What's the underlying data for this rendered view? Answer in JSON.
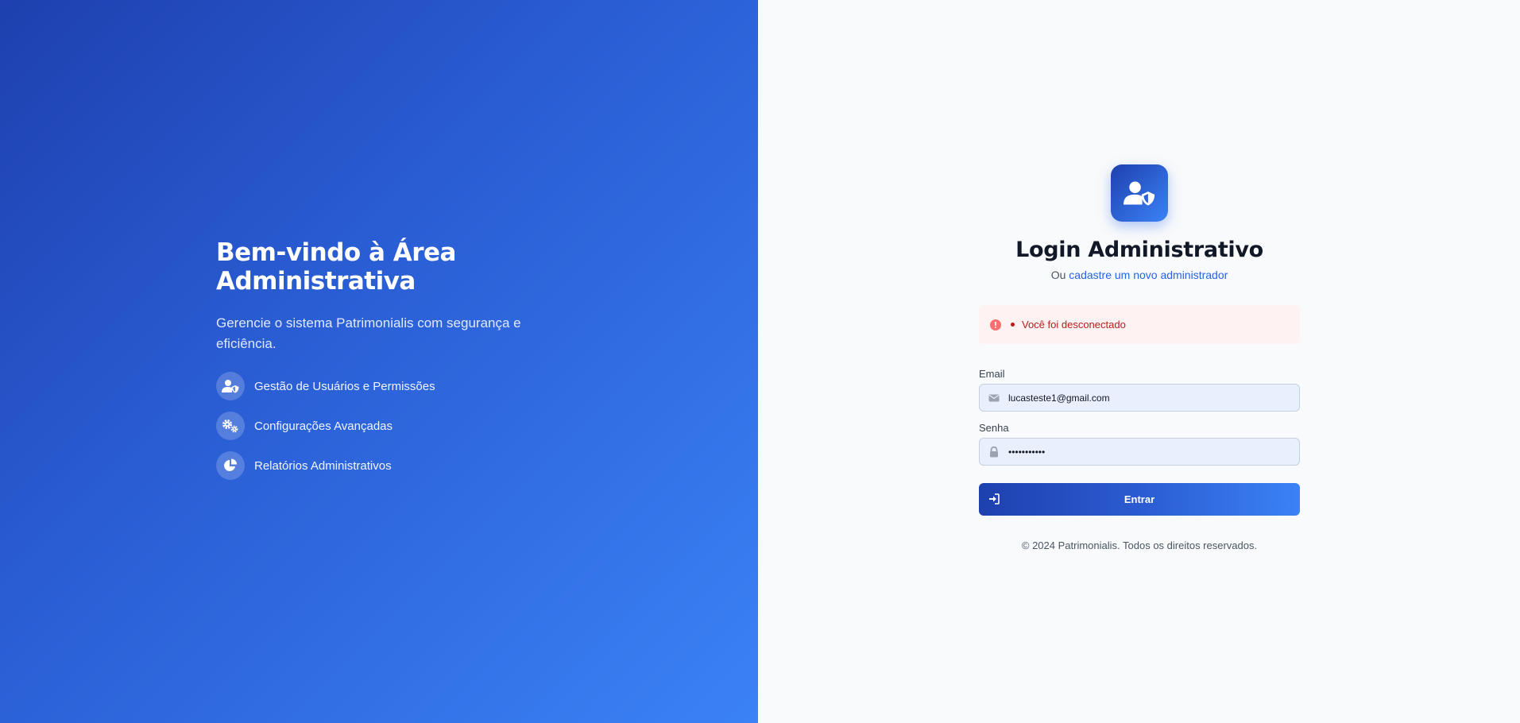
{
  "hero": {
    "title": "Bem-vindo à Área Administrativa",
    "subtitle": "Gerencie o sistema Patrimonialis com segurança e eficiência.",
    "features": [
      {
        "icon": "user-shield-icon",
        "label": "Gestão de Usuários e Permissões"
      },
      {
        "icon": "cogs-icon",
        "label": "Configurações Avançadas"
      },
      {
        "icon": "pie-chart-icon",
        "label": "Relatórios Administrativos"
      }
    ]
  },
  "login": {
    "logo_icon": "user-shield-icon",
    "title": "Login Administrativo",
    "subtitle_prefix": "Ou",
    "register_link": "cadastre um novo administrador",
    "alert": {
      "icon": "exclamation-circle-icon",
      "message": "Você foi desconectado"
    },
    "email": {
      "label": "Email",
      "icon": "envelope-icon",
      "value": "lucasteste1@gmail.com"
    },
    "password": {
      "label": "Senha",
      "icon": "lock-icon",
      "value": "•••••••••••"
    },
    "submit": {
      "icon": "sign-in-icon",
      "label": "Entrar"
    },
    "footer": "© 2024 Patrimonialis. Todos os direitos reservados."
  },
  "colors": {
    "brand_dark": "#1e40af",
    "brand_light": "#3b82f6",
    "link": "#2563eb",
    "alert_bg": "#fef2f2",
    "alert_text": "#b91c1c"
  }
}
